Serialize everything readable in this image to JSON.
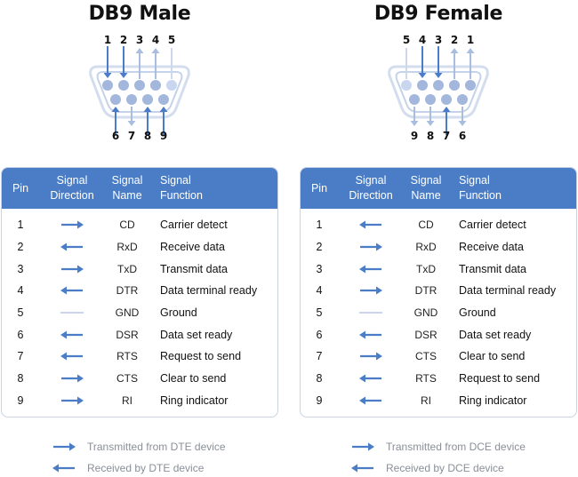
{
  "colors": {
    "accent": "#4a7dc6",
    "arrow": "#4a7dc6",
    "arrow_light": "#a9bde0",
    "ground_line": "#c9d5ea",
    "legend_text": "#8a8f98"
  },
  "male": {
    "title": "DB9 Male",
    "connector": {
      "top_pins": [
        {
          "pin": "1",
          "arrow": "in"
        },
        {
          "pin": "2",
          "arrow": "in"
        },
        {
          "pin": "3",
          "arrow": "out"
        },
        {
          "pin": "4",
          "arrow": "out"
        },
        {
          "pin": "5",
          "arrow": "none"
        }
      ],
      "bottom_pins": [
        {
          "pin": "6",
          "arrow": "in"
        },
        {
          "pin": "7",
          "arrow": "out"
        },
        {
          "pin": "8",
          "arrow": "in"
        },
        {
          "pin": "9",
          "arrow": "in"
        }
      ]
    },
    "table": {
      "headers": {
        "pin": "Pin",
        "direction_line1": "Signal",
        "direction_line2": "Direction",
        "name_line1": "Signal",
        "name_line2": "Name",
        "function_line1": "Signal",
        "function_line2": "Function"
      },
      "rows": [
        {
          "pin": "1",
          "direction": "right",
          "name": "CD",
          "function": "Carrier detect"
        },
        {
          "pin": "2",
          "direction": "left",
          "name": "RxD",
          "function": "Receive data"
        },
        {
          "pin": "3",
          "direction": "right",
          "name": "TxD",
          "function": "Transmit data"
        },
        {
          "pin": "4",
          "direction": "left",
          "name": "DTR",
          "function": "Data terminal ready"
        },
        {
          "pin": "5",
          "direction": "none",
          "name": "GND",
          "function": "Ground"
        },
        {
          "pin": "6",
          "direction": "left",
          "name": "DSR",
          "function": "Data set ready"
        },
        {
          "pin": "7",
          "direction": "left",
          "name": "RTS",
          "function": "Request to send"
        },
        {
          "pin": "8",
          "direction": "right",
          "name": "CTS",
          "function": "Clear to send"
        },
        {
          "pin": "9",
          "direction": "right",
          "name": "RI",
          "function": "Ring indicator"
        }
      ]
    },
    "legend": [
      {
        "icon": "arrow-right-icon",
        "label": "Transmitted from DTE device"
      },
      {
        "icon": "arrow-left-icon",
        "label": "Received by DTE device"
      }
    ]
  },
  "female": {
    "title": "DB9 Female",
    "connector": {
      "top_pins": [
        {
          "pin": "5",
          "arrow": "none"
        },
        {
          "pin": "4",
          "arrow": "in"
        },
        {
          "pin": "3",
          "arrow": "in"
        },
        {
          "pin": "2",
          "arrow": "out"
        },
        {
          "pin": "1",
          "arrow": "out"
        }
      ],
      "bottom_pins": [
        {
          "pin": "9",
          "arrow": "out"
        },
        {
          "pin": "8",
          "arrow": "out"
        },
        {
          "pin": "7",
          "arrow": "in"
        },
        {
          "pin": "6",
          "arrow": "out"
        }
      ]
    },
    "table": {
      "headers": {
        "pin": "Pin",
        "direction_line1": "Signal",
        "direction_line2": "Direction",
        "name_line1": "Signal",
        "name_line2": "Name",
        "function_line1": "Signal",
        "function_line2": "Function"
      },
      "rows": [
        {
          "pin": "1",
          "direction": "left",
          "name": "CD",
          "function": "Carrier detect"
        },
        {
          "pin": "2",
          "direction": "right",
          "name": "RxD",
          "function": "Receive data"
        },
        {
          "pin": "3",
          "direction": "left",
          "name": "TxD",
          "function": "Transmit data"
        },
        {
          "pin": "4",
          "direction": "right",
          "name": "DTR",
          "function": "Data terminal ready"
        },
        {
          "pin": "5",
          "direction": "none",
          "name": "GND",
          "function": "Ground"
        },
        {
          "pin": "6",
          "direction": "left",
          "name": "DSR",
          "function": "Data set ready"
        },
        {
          "pin": "7",
          "direction": "right",
          "name": "CTS",
          "function": "Clear to send"
        },
        {
          "pin": "8",
          "direction": "left",
          "name": "RTS",
          "function": "Request to send"
        },
        {
          "pin": "9",
          "direction": "left",
          "name": "RI",
          "function": "Ring indicator"
        }
      ]
    },
    "legend": [
      {
        "icon": "arrow-right-icon",
        "label": "Transmitted from DCE device"
      },
      {
        "icon": "arrow-left-icon",
        "label": "Received by DCE device"
      }
    ]
  }
}
